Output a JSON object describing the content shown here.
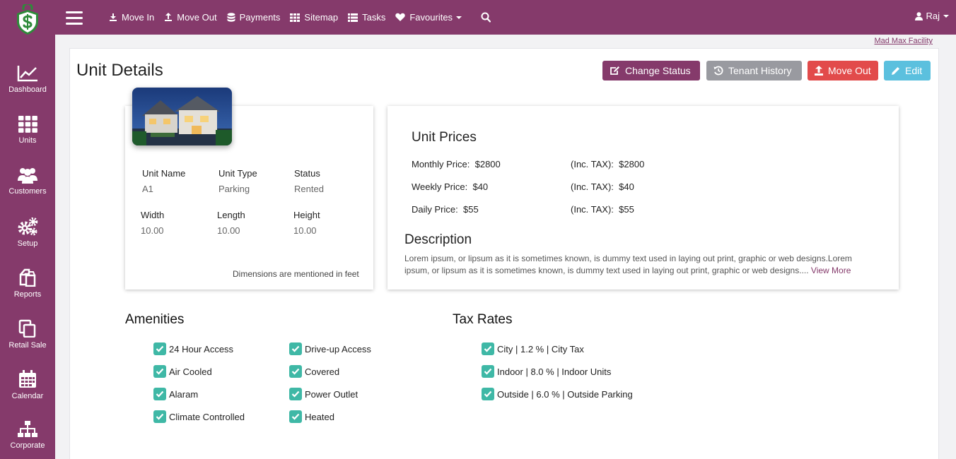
{
  "topbar": {
    "nav": [
      {
        "label": "Move In",
        "icon": "move-in-icon"
      },
      {
        "label": "Move Out",
        "icon": "move-out-icon"
      },
      {
        "label": "Payments",
        "icon": "database-icon"
      },
      {
        "label": "Sitemap",
        "icon": "grid-icon"
      },
      {
        "label": "Tasks",
        "icon": "list-icon"
      },
      {
        "label": "Favourites",
        "icon": "heart-icon"
      }
    ],
    "user": "Raj"
  },
  "sidebar": {
    "items": [
      {
        "label": "Dashboard",
        "icon": "chart-line-icon"
      },
      {
        "label": "Units",
        "icon": "grid-icon"
      },
      {
        "label": "Customers",
        "icon": "users-icon"
      },
      {
        "label": "Setup",
        "icon": "gears-icon"
      },
      {
        "label": "Reports",
        "icon": "reports-icon"
      },
      {
        "label": "Retail Sale",
        "icon": "copy-icon"
      },
      {
        "label": "Calendar",
        "icon": "calendar-icon"
      },
      {
        "label": "Corporate",
        "icon": "sitemap-icon"
      }
    ]
  },
  "facility": "Mad Max Facility",
  "page": {
    "title": "Unit Details",
    "buttons": {
      "change_status": "Change Status",
      "tenant_history": "Tenant History",
      "move_out": "Move Out",
      "edit": "Edit"
    }
  },
  "unit": {
    "name_label": "Unit Name",
    "name": "A1",
    "type_label": "Unit Type",
    "type": "Parking",
    "status_label": "Status",
    "status": "Rented",
    "width_label": "Width",
    "width": "10.00",
    "length_label": "Length",
    "length": "10.00",
    "height_label": "Height",
    "height": "10.00",
    "dimensions_note": "Dimensions are mentioned in feet"
  },
  "prices": {
    "title": "Unit Prices",
    "rows": [
      {
        "label": "Monthly Price:",
        "value": "$2800",
        "tax_label": "(Inc. TAX):",
        "tax_value": "$2800"
      },
      {
        "label": "Weekly Price:",
        "value": "$40",
        "tax_label": "(Inc. TAX):",
        "tax_value": "$40"
      },
      {
        "label": "Daily Price:",
        "value": "$55",
        "tax_label": "(Inc. TAX):",
        "tax_value": "$55"
      }
    ]
  },
  "description": {
    "title": "Description",
    "text": "Lorem ipsum, or lipsum as it is sometimes known, is dummy text used in laying out print, graphic or web designs.Lorem ipsum, or lipsum as it is sometimes known, is dummy text used in laying out print, graphic or web designs....",
    "view_more": "View More"
  },
  "amenities": {
    "title": "Amenities",
    "col1": [
      "24 Hour Access",
      "Air Cooled",
      "Alaram",
      "Climate Controlled"
    ],
    "col2": [
      "Drive-up Access",
      "Covered",
      "Power Outlet",
      "Heated"
    ]
  },
  "tax_rates": {
    "title": "Tax Rates",
    "items": [
      "City | 1.2 % | City Tax",
      "Indoor | 8.0 % | Indoor Units",
      "Outside | 6.0 % | Outside Parking"
    ]
  },
  "colors": {
    "brand": "#853a6b",
    "check": "#3fb8a6",
    "danger": "#e24b4b",
    "info": "#5bc0de",
    "muted": "#999aa0"
  }
}
